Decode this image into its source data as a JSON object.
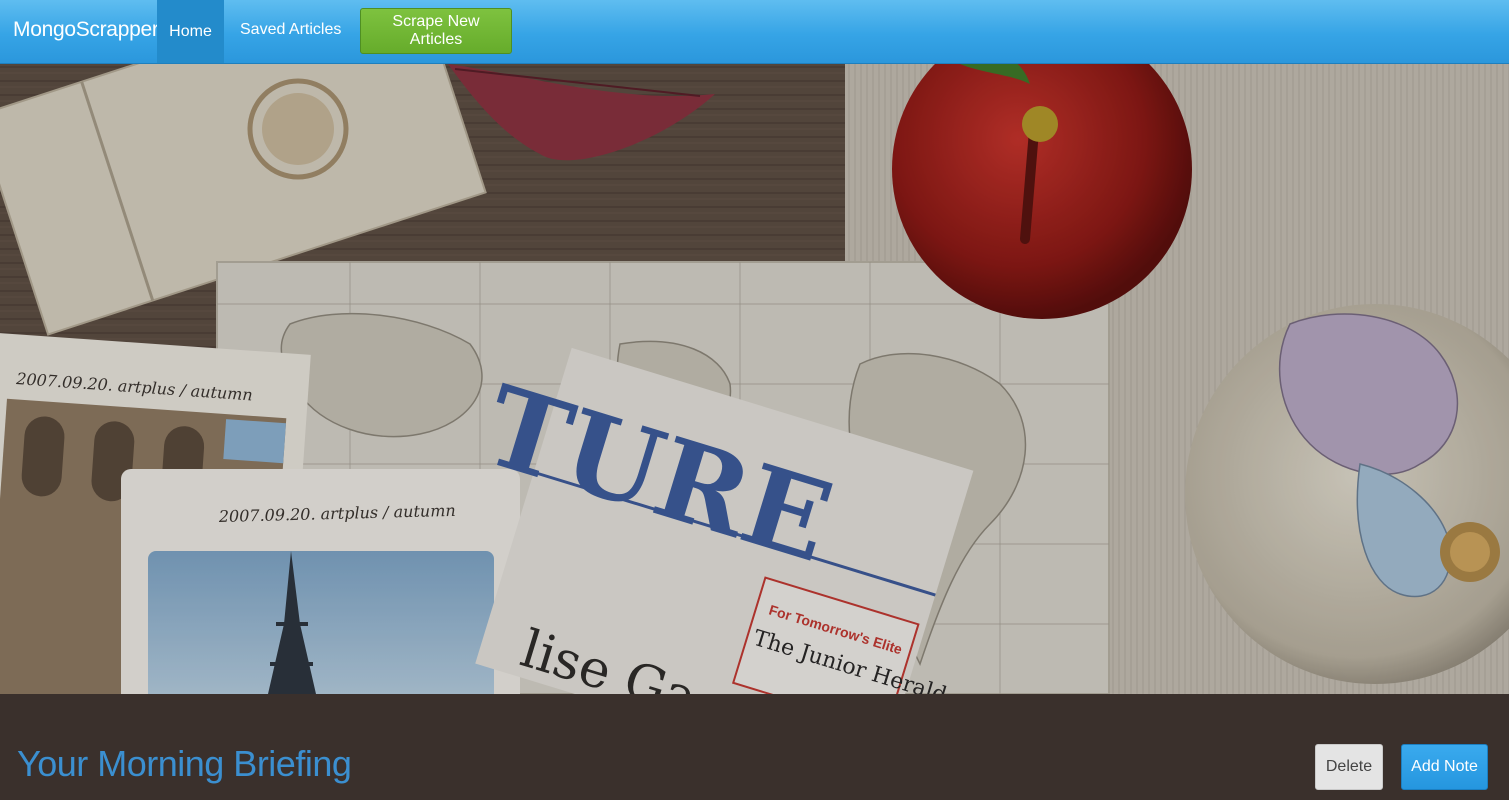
{
  "navbar": {
    "brand": "MongoScrapper",
    "home_label": "Home",
    "saved_label": "Saved Articles",
    "scrape_label": "Scrape New Articles"
  },
  "hero": {
    "photo_caption_back": "2007.09.20. artplus / autumn",
    "photo_caption_front": "2007.09.20. artplus / autumn",
    "newspaper_headline": "TURE",
    "newspaper_subline": "lise Ga",
    "tag_line": "For Tomorrow's Elite",
    "tag_title": "The Junior Herald"
  },
  "briefing": {
    "title": "Your Morning Briefing",
    "delete_label": "Delete",
    "add_note_label": "Add Note"
  },
  "colors": {
    "navbar": "#36a4e6",
    "home_active": "#238bcb",
    "scrape_button": "#6db434",
    "panel": "#3a302c",
    "title": "#3b8fd0",
    "add_note": "#2c9ee4"
  }
}
